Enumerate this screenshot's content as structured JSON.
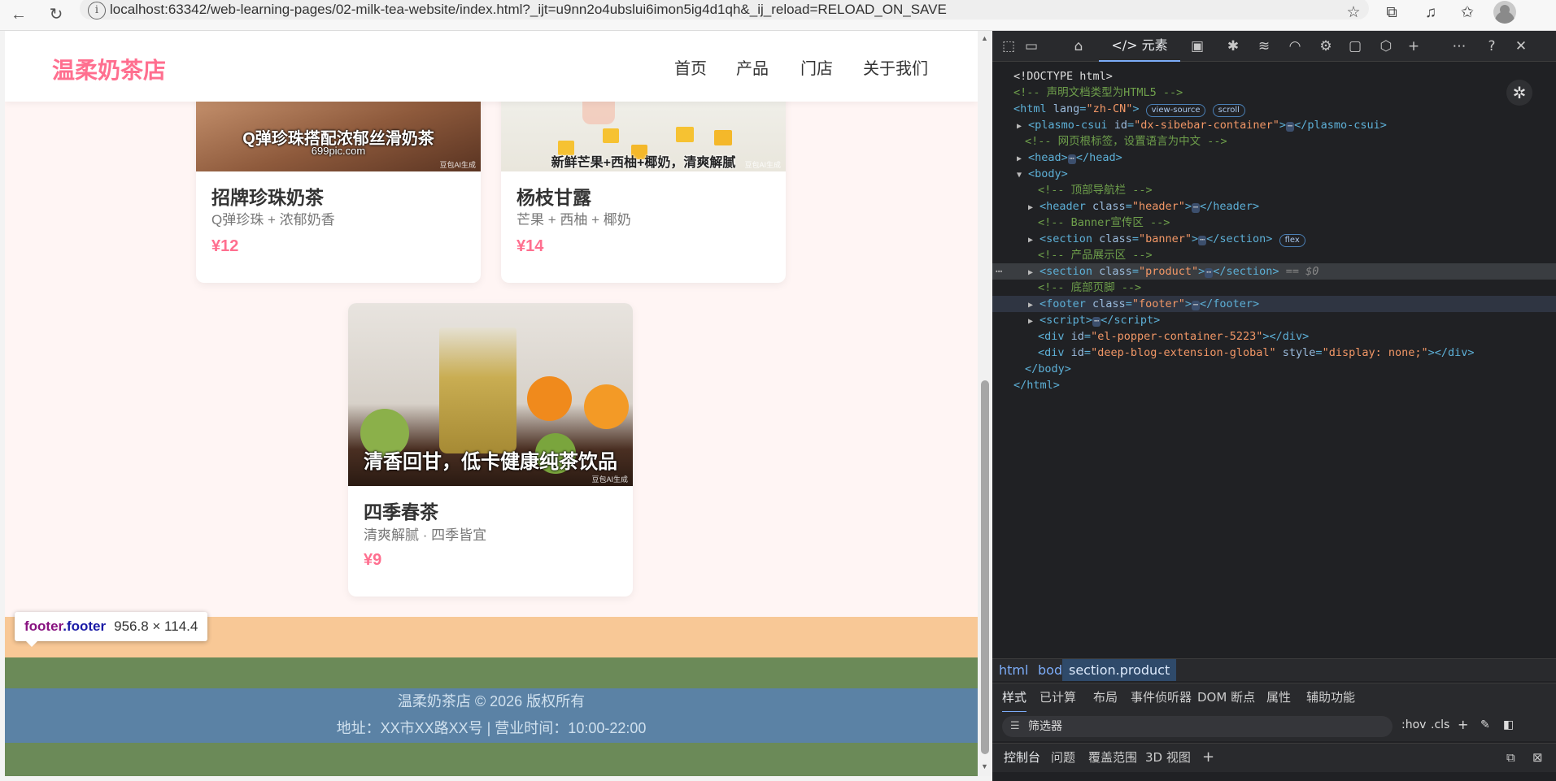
{
  "browser": {
    "url": "localhost:63342/web-learning-pages/02-milk-tea-website/index.html?_ijt=u9nn2o4ubslui6imon5ig4d1qh&_ij_reload=RELOAD_ON_SAVE"
  },
  "site": {
    "logo": "温柔奶茶店",
    "nav": [
      "首页",
      "产品",
      "门店",
      "关于我们"
    ]
  },
  "products": [
    {
      "name": "招牌珍珠奶茶",
      "desc": "Q弹珍珠 + 浓郁奶香",
      "price": "¥12",
      "img_caption": "Q弹珍珠搭配浓郁丝滑奶茶",
      "img_subcaption": "699pic.com",
      "watermark": "豆包AI生成"
    },
    {
      "name": "杨枝甘露",
      "desc": "芒果 + 西柚 + 椰奶",
      "price": "¥14",
      "img_caption": "新鲜芒果+西柚+椰奶，清爽解腻",
      "watermark": "豆包AI生成"
    },
    {
      "name": "四季春茶",
      "desc": "清爽解腻 · 四季皆宜",
      "price": "¥9",
      "img_caption": "清香回甘，低卡健康纯茶饮品",
      "watermark": "豆包AI生成"
    }
  ],
  "footer": {
    "line1": "温柔奶茶店 © 2026 版权所有",
    "line2": "地址：XX市XX路XX号 | 营业时间：10:00-22:00"
  },
  "tooltip": {
    "tag": "footer",
    "cls": ".footer",
    "size": "956.8 × 114.4"
  },
  "devtools": {
    "active_tab": "元素",
    "dom": {
      "doctype": "<!DOCTYPE html>",
      "c_doctype": "<!-- 声明文档类型为HTML5 -->",
      "html_open": "<html",
      "html_lang_attr": "lang",
      "html_lang_val": "\"zh-CN\"",
      "pill_view_source": "view-source",
      "pill_scroll": "scroll",
      "plasmo": "plasmo-csui",
      "plasmo_id": "\"dx-sibebar-container\"",
      "c_root": "<!-- 网页根标签，设置语言为中文 -->",
      "head": "head",
      "body": "body",
      "c_header": "<!-- 顶部导航栏 -->",
      "header_cls": "\"header\"",
      "c_banner": "<!-- Banner宣传区 -->",
      "banner_cls": "\"banner\"",
      "pill_flex": "flex",
      "c_product": "<!-- 产品展示区 -->",
      "product_cls": "\"product\"",
      "dollar0": "== $0",
      "c_footer": "<!-- 底部页脚 -->",
      "footer_cls": "\"footer\"",
      "script": "script",
      "div1_id": "\"el-popper-container-5223\"",
      "div2_id": "\"deep-blog-extension-global\"",
      "div2_style": "\"display: none;\"",
      "body_close": "</body>",
      "html_close": "</html>"
    },
    "breadcrumb": [
      "html",
      "body",
      "section.product"
    ],
    "style_tabs": [
      "样式",
      "已计算",
      "布局",
      "事件侦听器",
      "DOM 断点",
      "属性",
      "辅助功能"
    ],
    "filter_placeholder": "筛选器",
    "filter_hov": ":hov",
    "filter_cls": ".cls",
    "drawer_tabs": [
      "控制台",
      "问题",
      "覆盖范围",
      "3D 视图"
    ]
  }
}
